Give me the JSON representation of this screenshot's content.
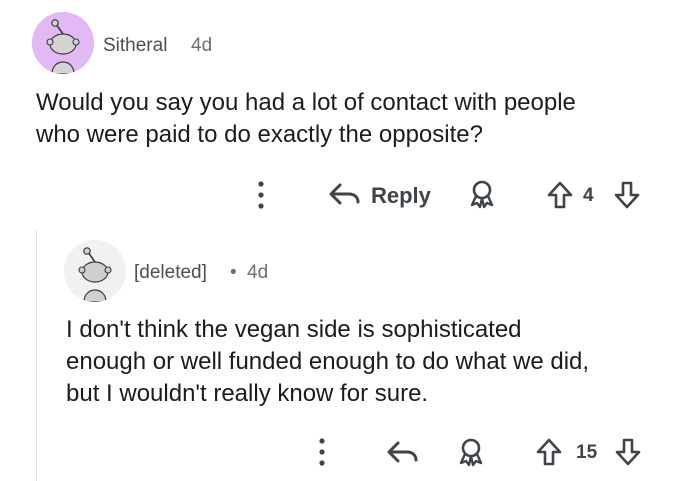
{
  "comments": [
    {
      "username": "Sitheral",
      "age": "4d",
      "separator": "",
      "body_lines": [
        "Would you say you had a lot of contact with people",
        "who were paid to do exactly the opposite?"
      ],
      "actions": {
        "more_icon": "more-vertical-icon",
        "reply_label": "Reply",
        "award_icon": "award-icon",
        "score": "4"
      },
      "avatar_bg": "#e2b8f5"
    },
    {
      "username": "[deleted]",
      "age": "4d",
      "separator": "•",
      "body_lines": [
        "I don't think the vegan side is sophisticated",
        "enough or well funded enough to do what we did,",
        "but I wouldn't really know for sure."
      ],
      "actions": {
        "more_icon": "more-vertical-icon",
        "reply_label": "",
        "award_icon": "award-icon",
        "score": "15"
      },
      "avatar_bg": "#f1f1f2"
    }
  ],
  "colors": {
    "text": "#1c1c1c",
    "meta": "#6a6f75",
    "icon": "#3f4449",
    "thread_line": "#dcdde0"
  }
}
